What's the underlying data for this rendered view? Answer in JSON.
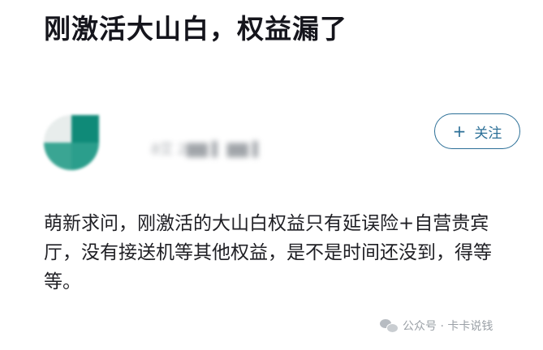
{
  "post": {
    "title": "刚激活大山白，权益漏了",
    "body": "萌新求问，刚激活的大山白权益只有延误险+自营贵宾厅，没有接送机等其他权益，是不是时间还没到，得等等。"
  },
  "author": {
    "name": "𐐀艾 2▇▇ ▌ ▇▇ ▌",
    "avatar_colors": [
      "#e8edec",
      "#0f8a78",
      "#3aa593",
      "#2b9e8c"
    ]
  },
  "follow_button": {
    "icon": "plus-icon",
    "icon_glyph": "+",
    "label": "关注",
    "color": "#2b6f97"
  },
  "watermark": {
    "icon": "wechat-icon",
    "text": "公众号 · 卡卡说钱"
  }
}
